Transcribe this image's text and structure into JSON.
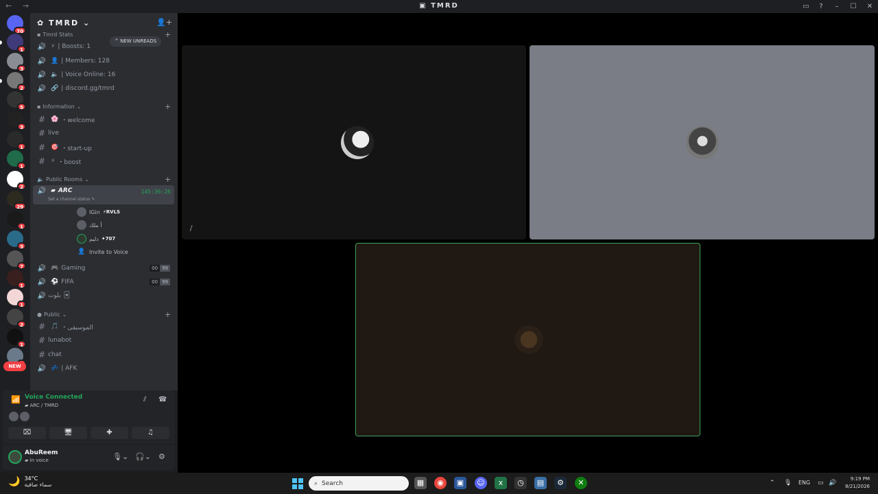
{
  "window": {
    "title": "TMRD",
    "nav_back": "←",
    "nav_forward": "→"
  },
  "servers": {
    "badges": [
      "70",
      "1",
      "3",
      "2",
      "5",
      "3",
      "1",
      "1",
      "2",
      "29",
      "1",
      "3",
      "7",
      "1",
      "1",
      "2",
      "1",
      "1"
    ],
    "new_label": "NEW"
  },
  "sidebar": {
    "guild_name": "TMRD",
    "new_unreads": "NEW UNREADS",
    "categories": {
      "stats": "Tmrd Stats",
      "information": "Information",
      "public_rooms": "Public Rooms",
      "public": "Public"
    },
    "stats_channels": [
      "| Boosts: 1",
      "| Members: 128",
      "| Voice Online: 16",
      "| discord.gg/tmrd"
    ],
    "info_channels": [
      "・welcome",
      "live",
      "・start-up",
      "・boost"
    ],
    "active_voice": {
      "name": "ARC",
      "timer": "145:36:26",
      "status": "Set a channel status"
    },
    "voice_users": [
      {
        "name": "IGin",
        "tag": "RVLS"
      },
      {
        "name": "أ ملك",
        "tag": ""
      },
      {
        "name": "دليم",
        "tag": "707"
      }
    ],
    "invite_label": "Invite to Voice",
    "voice_rooms": [
      {
        "name": "Gaming",
        "count_a": "00",
        "count_b": "99"
      },
      {
        "name": "FIFA",
        "count_a": "00",
        "count_b": "99"
      },
      {
        "name": "بلوت",
        "count_a": "",
        "count_b": ""
      }
    ],
    "public_channels": [
      "・الموسيقى",
      "lunabot",
      "chat",
      "| AFK"
    ]
  },
  "voice_panel": {
    "title": "Voice Connected",
    "subtitle": "ARC / TMRD"
  },
  "user_panel": {
    "name": "AbuReem",
    "status": "In voice"
  },
  "taskbar": {
    "temperature": "34°C",
    "weather_desc": "سماء صافية",
    "search_placeholder": "Search",
    "language": "ENG",
    "time": "9:19 PM",
    "date": "8/21/2026"
  },
  "colors": {
    "accent_green": "#23a55a",
    "badge_red": "#f23f43",
    "sidebar_bg": "#2b2d31",
    "stage_bg": "#000000"
  }
}
